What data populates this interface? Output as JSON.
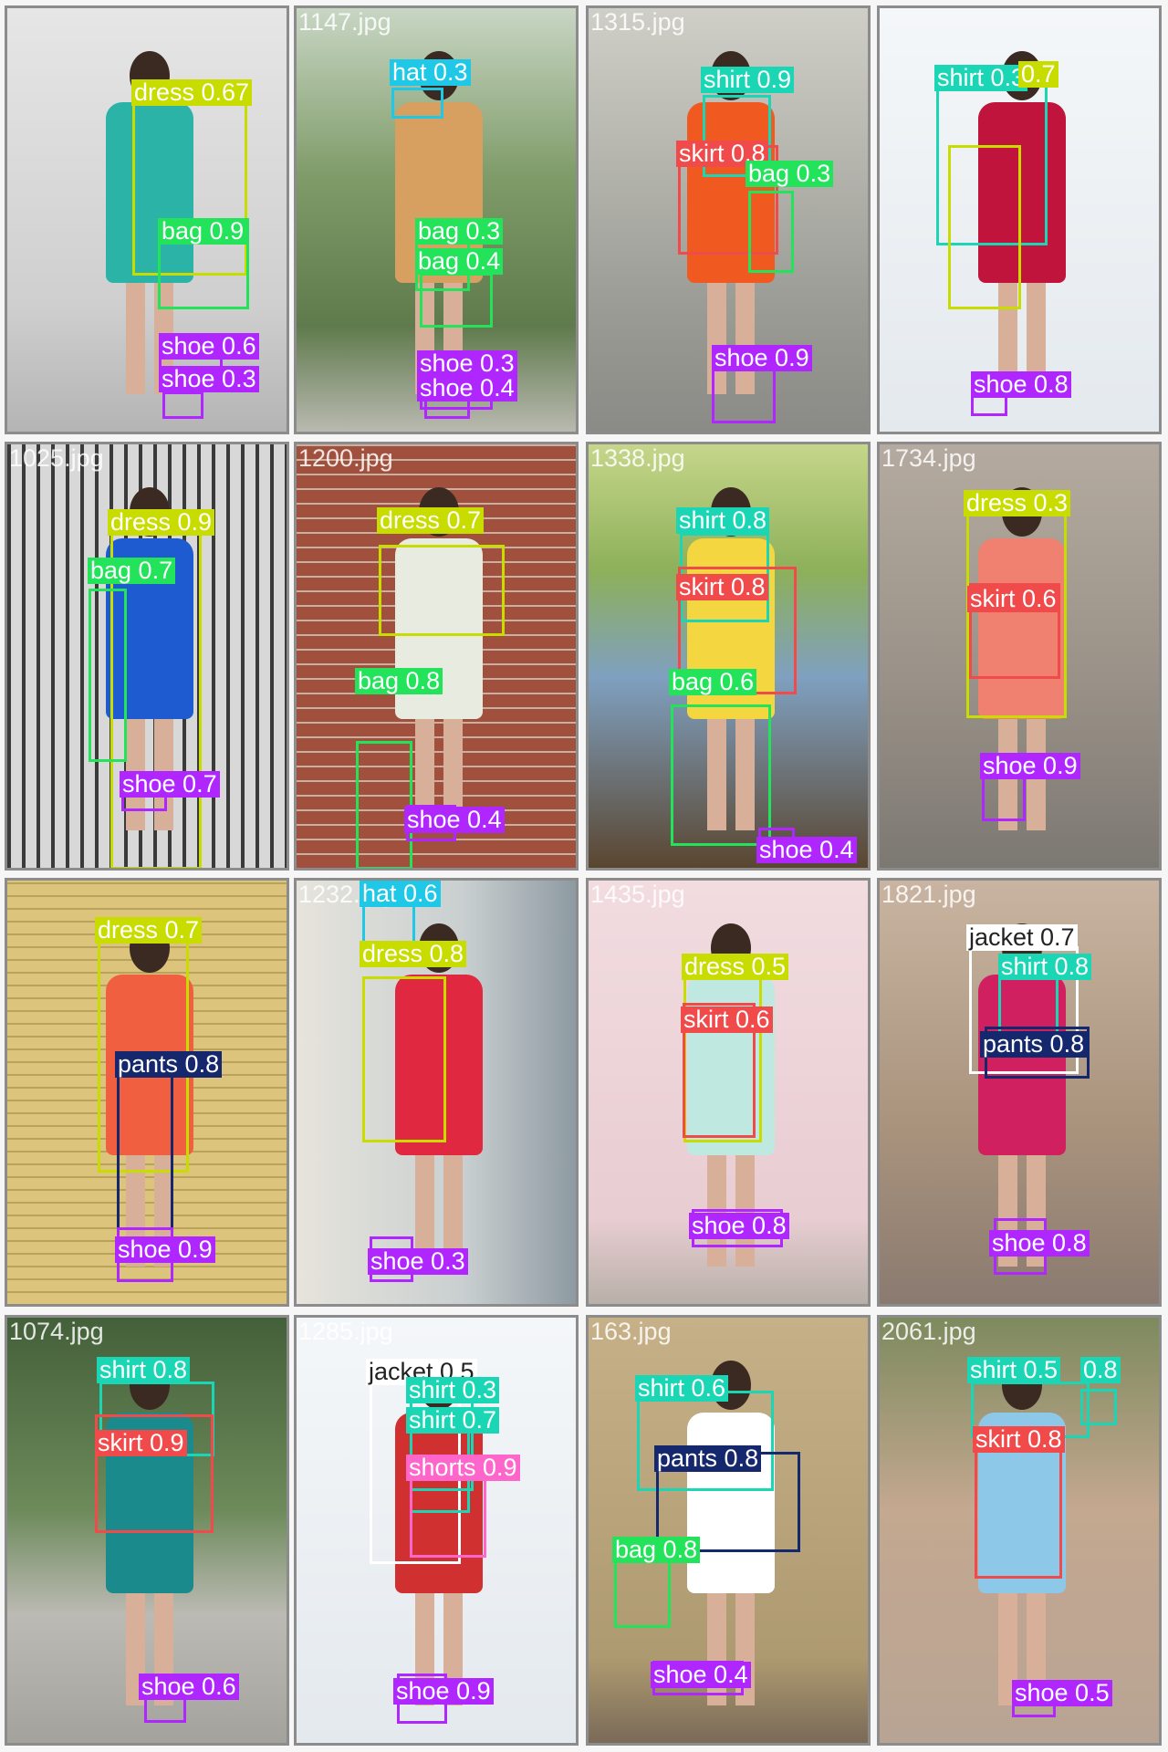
{
  "grid": {
    "tiles": [
      {
        "filename": "",
        "bg": "#cfcfcf",
        "scene": "concrete",
        "outfit": "#2bb3a8",
        "detections": [
          {
            "label": "dress 0.67",
            "cls": "dress"
          },
          {
            "label": "bag 0.9",
            "cls": "bag"
          },
          {
            "label": "shoe 0.6",
            "cls": "shoe"
          },
          {
            "label": "shoe 0.3",
            "cls": "shoe"
          }
        ]
      },
      {
        "filename": "1147.jpg",
        "bg": "#6f8a5a",
        "scene": "garden",
        "outfit": "#d8a060",
        "detections": [
          {
            "label": "hat 0.3",
            "cls": "hat"
          },
          {
            "label": "bag 0.3",
            "cls": "bag"
          },
          {
            "label": "bag 0.4",
            "cls": "bag"
          },
          {
            "label": "shoe 0.3",
            "cls": "shoe"
          },
          {
            "label": "shoe 0.4",
            "cls": "shoe"
          }
        ]
      },
      {
        "filename": "1315.jpg",
        "bg": "#a8a8a2",
        "scene": "wall",
        "outfit": "#f05a20",
        "detections": [
          {
            "label": "shirt 0.9",
            "cls": "shirt"
          },
          {
            "label": "skirt 0.8",
            "cls": "skirt"
          },
          {
            "label": "bag 0.3",
            "cls": "bag"
          },
          {
            "label": "shoe 0.9",
            "cls": "shoe"
          }
        ]
      },
      {
        "filename": "",
        "bg": "#eaf0f4",
        "scene": "white",
        "outfit": "#c0143c",
        "detections": [
          {
            "label": "shirt 0.3",
            "cls": "shirt"
          },
          {
            "label": "0.7",
            "cls": "dress"
          },
          {
            "label": "shoe 0.8",
            "cls": "shoe"
          }
        ]
      },
      {
        "filename": "1025.jpg",
        "bg": "#8a8a88",
        "scene": "gate",
        "outfit": "#1f5bd0",
        "detections": [
          {
            "label": "dress 0.9",
            "cls": "dress"
          },
          {
            "label": "bag 0.7",
            "cls": "bag"
          },
          {
            "label": "shoe 0.7",
            "cls": "shoe"
          }
        ]
      },
      {
        "filename": "1200.jpg",
        "bg": "#9c4a3a",
        "scene": "brick",
        "outfit": "#e8ece0",
        "detections": [
          {
            "label": "dress 0.7",
            "cls": "dress"
          },
          {
            "label": "bag 0.8",
            "cls": "bag"
          },
          {
            "label": "shoe 0.4",
            "cls": "shoe"
          }
        ]
      },
      {
        "filename": "1338.jpg",
        "bg": "#8fa8c0",
        "scene": "lake",
        "outfit": "#f4d640",
        "detections": [
          {
            "label": "shirt 0.8",
            "cls": "shirt"
          },
          {
            "label": "skirt 0.8",
            "cls": "skirt"
          },
          {
            "label": "bag 0.6",
            "cls": "bag"
          },
          {
            "label": "shoe 0.4",
            "cls": "shoe"
          }
        ]
      },
      {
        "filename": "1734.jpg",
        "bg": "#9a928a",
        "scene": "graffiti",
        "outfit": "#f08070",
        "detections": [
          {
            "label": "dress 0.3",
            "cls": "dress"
          },
          {
            "label": "skirt 0.6",
            "cls": "skirt"
          },
          {
            "label": "shoe 0.9",
            "cls": "shoe"
          }
        ]
      },
      {
        "filename": "",
        "bg": "#d9c27a",
        "scene": "yellowbrick",
        "outfit": "#f06040",
        "detections": [
          {
            "label": "dress 0.7",
            "cls": "dress"
          },
          {
            "label": "pants 0.8",
            "cls": "pants"
          },
          {
            "label": "shoe 0.9",
            "cls": "shoe"
          }
        ]
      },
      {
        "filename": "1232.jpg",
        "bg": "#d8d8d0",
        "scene": "balcony",
        "outfit": "#e02840",
        "detections": [
          {
            "label": "hat 0.6",
            "cls": "hat"
          },
          {
            "label": "dress 0.8",
            "cls": "dress"
          },
          {
            "label": "shoe 0.3",
            "cls": "shoe"
          }
        ]
      },
      {
        "filename": "1435.jpg",
        "bg": "#eed8dc",
        "scene": "pink",
        "outfit": "#bfe8e0",
        "detections": [
          {
            "label": "dress 0.5",
            "cls": "dress"
          },
          {
            "label": "skirt 0.6",
            "cls": "skirt"
          },
          {
            "label": "shoe 0.8",
            "cls": "shoe"
          }
        ]
      },
      {
        "filename": "1821.jpg",
        "bg": "#b09a84",
        "scene": "stone",
        "outfit": "#d02060",
        "detections": [
          {
            "label": "jacket 0.7",
            "cls": "jacket"
          },
          {
            "label": "shirt 0.8",
            "cls": "shirt"
          },
          {
            "label": "pants 0.8",
            "cls": "pants"
          },
          {
            "label": "shoe 0.8",
            "cls": "shoe"
          }
        ]
      },
      {
        "filename": "1074.jpg",
        "bg": "#5f7a54",
        "scene": "street",
        "outfit": "#1a8a8c",
        "detections": [
          {
            "label": "shirt 0.8",
            "cls": "shirt"
          },
          {
            "label": "skirt 0.9",
            "cls": "skirt"
          },
          {
            "label": "shoe 0.6",
            "cls": "shoe"
          }
        ]
      },
      {
        "filename": "1285.jpg",
        "bg": "#f2f2f2",
        "scene": "white",
        "outfit": "#d03030",
        "detections": [
          {
            "label": "jacket 0.5",
            "cls": "jacket"
          },
          {
            "label": "shirt 0.3",
            "cls": "shirt"
          },
          {
            "label": "shirt 0.7",
            "cls": "shirt"
          },
          {
            "label": "shorts 0.9",
            "cls": "shorts"
          },
          {
            "label": "shoe 0.9",
            "cls": "shoe"
          }
        ]
      },
      {
        "filename": "163.jpg",
        "bg": "#b8a47a",
        "scene": "stucco",
        "outfit": "#ffffff",
        "detections": [
          {
            "label": "shirt 0.6",
            "cls": "shirt"
          },
          {
            "label": "pants 0.8",
            "cls": "pants"
          },
          {
            "label": "bag 0.8",
            "cls": "bag"
          },
          {
            "label": "shoe 0.4",
            "cls": "shoe"
          }
        ]
      },
      {
        "filename": "2061.jpg",
        "bg": "#a89080",
        "scene": "road",
        "outfit": "#8ec8e8",
        "detections": [
          {
            "label": "shirt 0.5",
            "cls": "shirt"
          },
          {
            "label": "0.8",
            "cls": "shirt"
          },
          {
            "label": "skirt 0.8",
            "cls": "skirt"
          },
          {
            "label": "shoe 0.5",
            "cls": "shoe"
          }
        ]
      }
    ]
  },
  "classes": {
    "dress": {
      "color": "#c8dc00",
      "text_color": "#ffffff"
    },
    "bag": {
      "color": "#22e35a",
      "text_color": "#ffffff"
    },
    "shoe": {
      "color": "#b026ff",
      "text_color": "#ffffff"
    },
    "hat": {
      "color": "#1ec8e6",
      "text_color": "#ffffff"
    },
    "shirt": {
      "color": "#1ad6b4",
      "text_color": "#ffffff"
    },
    "skirt": {
      "color": "#f04a4a",
      "text_color": "#ffffff"
    },
    "pants": {
      "color": "#15286e",
      "text_color": "#ffffff"
    },
    "jacket": {
      "color": "#ffffff",
      "text_color": "#222222"
    },
    "shorts": {
      "color": "#ff66cc",
      "text_color": "#ffffff"
    }
  }
}
